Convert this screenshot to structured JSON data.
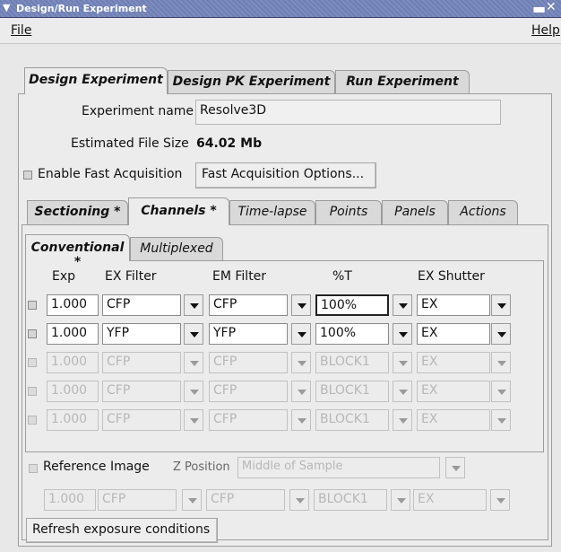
{
  "window": {
    "title": "Design/Run Experiment"
  },
  "menu": {
    "file": "File",
    "help": "Help"
  },
  "top_tabs": [
    "Design Experiment",
    "Design PK Experiment",
    "Run Experiment"
  ],
  "experiment": {
    "name_label": "Experiment name",
    "name_value": "Resolve3D",
    "size_label": "Estimated File Size",
    "size_value": "64.02 Mb",
    "fast_acq_label": "Enable Fast Acquisition",
    "fast_acq_button": "Fast Acquisition Options..."
  },
  "sub_tabs": [
    "Sectioning *",
    "Channels *",
    "Time-lapse",
    "Points",
    "Panels",
    "Actions"
  ],
  "channel_tabs": [
    "Conventional *",
    "Multiplexed"
  ],
  "table": {
    "headers": [
      "Exp",
      "EX Filter",
      "EM Filter",
      "%T",
      "EX Shutter"
    ],
    "rows": [
      {
        "exp": "1.000",
        "ex": "CFP",
        "em": "CFP",
        "t": "100%",
        "sh": "EX",
        "enabled": true
      },
      {
        "exp": "1.000",
        "ex": "YFP",
        "em": "YFP",
        "t": "100%",
        "sh": "EX",
        "enabled": true
      },
      {
        "exp": "1.000",
        "ex": "CFP",
        "em": "CFP",
        "t": "BLOCK1",
        "sh": "EX",
        "enabled": false
      },
      {
        "exp": "1.000",
        "ex": "CFP",
        "em": "CFP",
        "t": "BLOCK1",
        "sh": "EX",
        "enabled": false
      },
      {
        "exp": "1.000",
        "ex": "CFP",
        "em": "CFP",
        "t": "BLOCK1",
        "sh": "EX",
        "enabled": false
      }
    ]
  },
  "reference": {
    "label": "Reference Image",
    "zpos_label": "Z Position",
    "zpos_value": "Middle of Sample",
    "exp": "1.000",
    "ex": "CFP",
    "em": "CFP",
    "t": "BLOCK1",
    "sh": "EX"
  },
  "refresh_button": "Refresh exposure conditions"
}
